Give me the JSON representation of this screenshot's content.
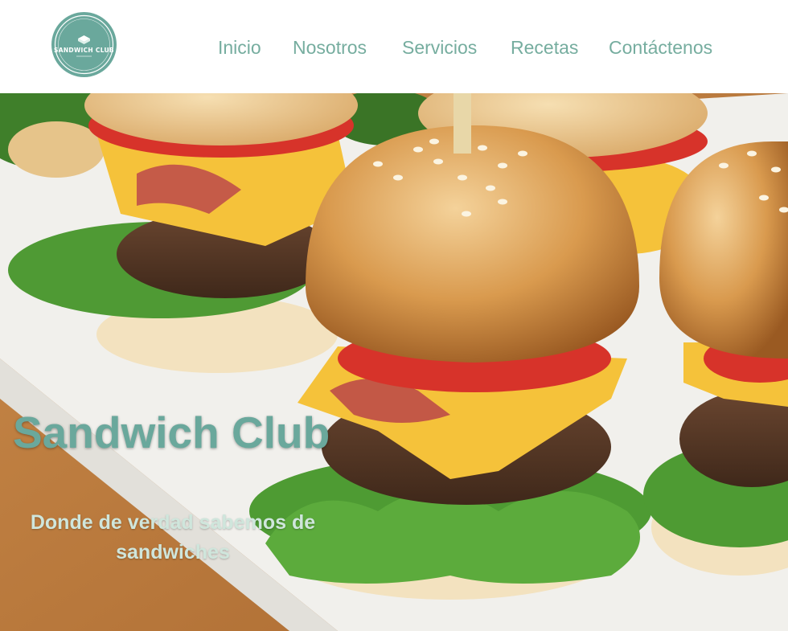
{
  "header": {
    "logo": {
      "text": "SANDWICH CLUB",
      "icon": "sandwich-icon",
      "color": "#6aa89c"
    },
    "nav": [
      {
        "label": "Inicio"
      },
      {
        "label": "Nosotros"
      },
      {
        "label": "Servicios"
      },
      {
        "label": "Recetas"
      },
      {
        "label": "Contáctenos"
      }
    ],
    "nav_color": "#76ad9f"
  },
  "hero": {
    "title": "Sandwich Club",
    "subtitle": "Donde de verdad sabemos de sandwiches",
    "image": "sliders-burgers-photo",
    "title_color": "#6aa89c"
  }
}
